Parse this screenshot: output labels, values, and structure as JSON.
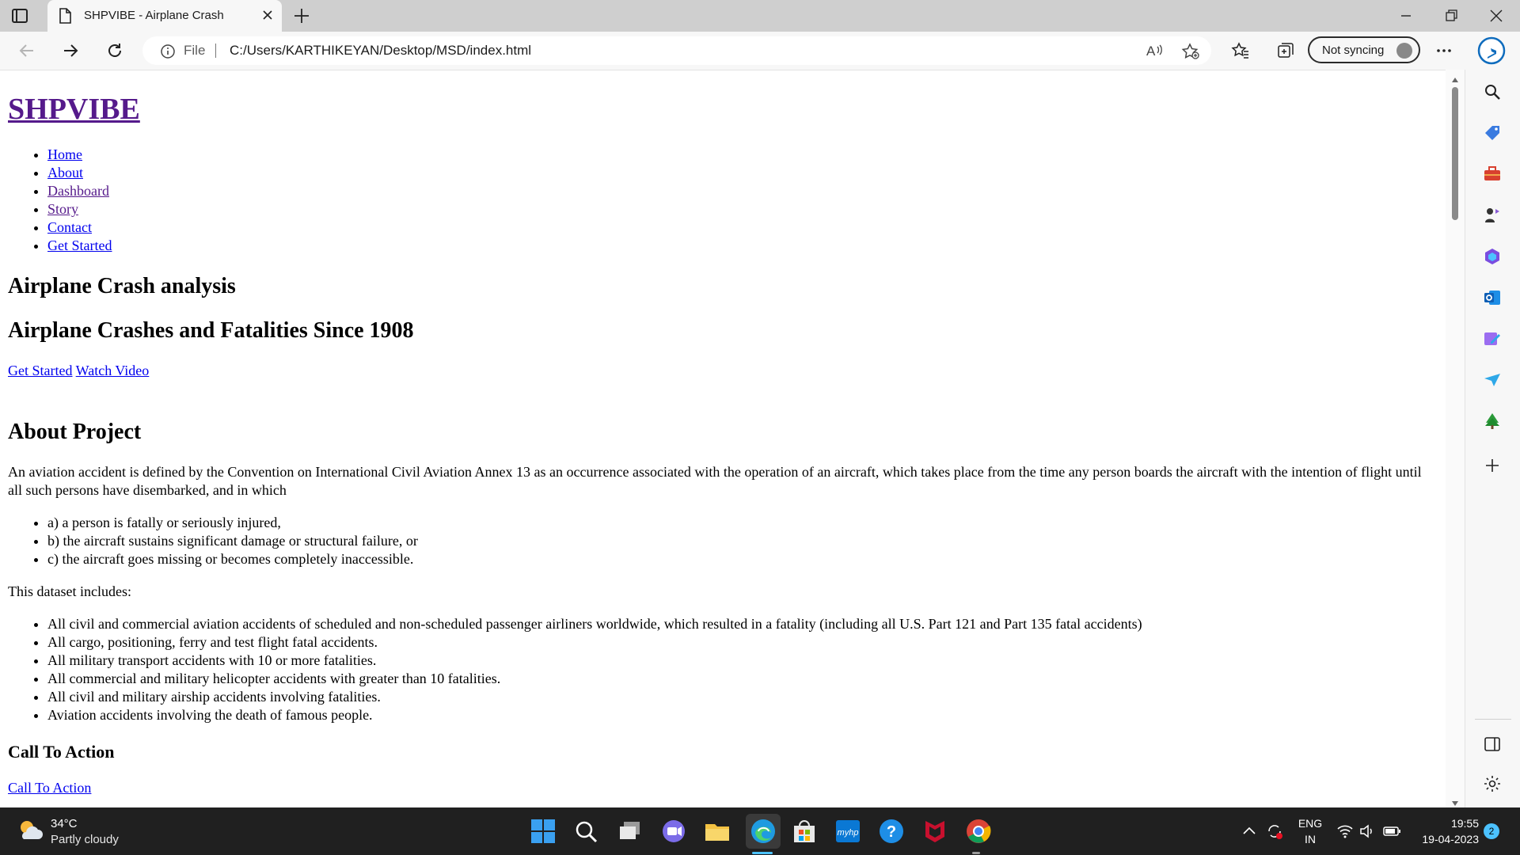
{
  "browser": {
    "tab_title": "SHPVIBE - Airplane Crash",
    "address": {
      "scheme_label": "File",
      "url": "C:/Users/KARTHIKEYAN/Desktop/MSD/index.html"
    },
    "sync_label": "Not syncing"
  },
  "page": {
    "brand": "SHPVIBE",
    "nav": [
      {
        "label": "Home"
      },
      {
        "label": "About"
      },
      {
        "label": "Dashboard"
      },
      {
        "label": "Story"
      },
      {
        "label": "Contact"
      },
      {
        "label": "Get Started"
      }
    ],
    "hero": {
      "title": "Airplane Crash analysis",
      "subtitle": "Airplane Crashes and Fatalities Since 1908",
      "get_started": "Get Started",
      "watch_video": "Watch Video"
    },
    "about": {
      "heading": "About Project",
      "intro": "An aviation accident is defined by the Convention on International Civil Aviation Annex 13 as an occurrence associated with the operation of an aircraft, which takes place from the time any person boards the aircraft with the intention of flight until all such persons have disembarked, and in which",
      "conditions": [
        "a) a person is fatally or seriously injured,",
        "b) the aircraft sustains significant damage or structural failure, or",
        "c) the aircraft goes missing or becomes completely inaccessible."
      ],
      "dataset_intro": "This dataset includes:",
      "dataset_items": [
        "All civil and commercial aviation accidents of scheduled and non-scheduled passenger airliners worldwide, which resulted in a fatality (including all U.S. Part 121 and Part 135 fatal accidents)",
        "All cargo, positioning, ferry and test flight fatal accidents.",
        "All military transport accidents with 10 or more fatalities.",
        "All commercial and military helicopter accidents with greater than 10 fatalities.",
        "All civil and military airship accidents involving fatalities.",
        "Aviation accidents involving the death of famous people."
      ]
    },
    "cta": {
      "heading": "Call To Action",
      "link": "Call To Action"
    }
  },
  "taskbar": {
    "weather_temp": "34°C",
    "weather_desc": "Partly cloudy",
    "lang_top": "ENG",
    "lang_bottom": "IN",
    "time": "19:55",
    "date": "19-04-2023",
    "notification_count": "2",
    "hp_label": "myhp"
  },
  "colors": {
    "link": "#0000ee",
    "visited_link": "#551a8b",
    "taskbar": "#202020",
    "edge_accent": "#0f6cbd"
  }
}
